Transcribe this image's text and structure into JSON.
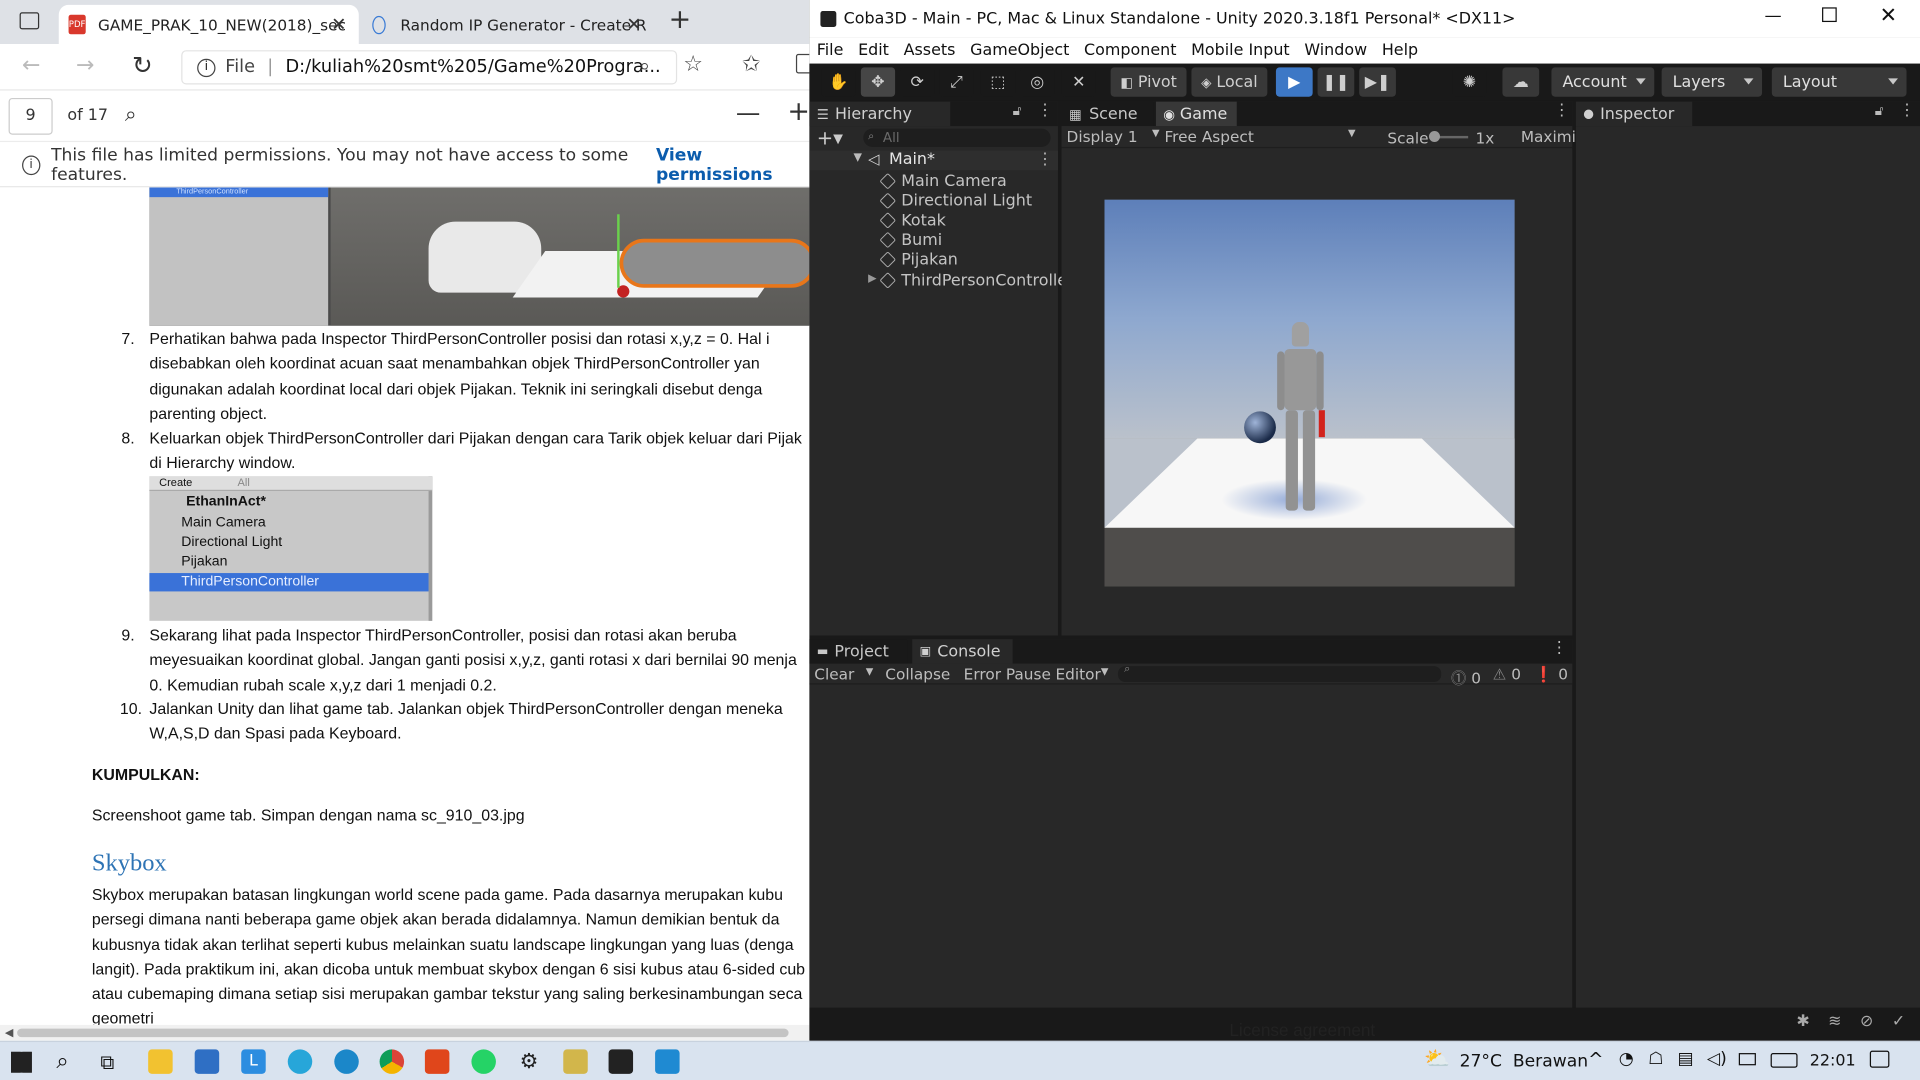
{
  "browser": {
    "tabs": [
      {
        "title": "GAME_PRAK_10_NEW(2018)_sec"
      },
      {
        "title": "Random IP Generator - Create R"
      }
    ],
    "address_scheme": "File",
    "address": "D:/kuliah%20smt%205/Game%20Progra...",
    "pdf": {
      "page": "9",
      "of": "of 17"
    },
    "notice": "This file has limited permissions. You may not have access to some features.",
    "notice_link": "View permissions"
  },
  "document": {
    "top_image_label": "ThirdPersonController",
    "items": [
      {
        "num": "7.",
        "lines": [
          "Perhatikan bahwa pada Inspector ThirdPersonController posisi dan rotasi x,y,z = 0. Hal i",
          "disebabkan oleh koordinat acuan saat menambahkan objek ThirdPersonController yan",
          "digunakan adalah koordinat local dari objek Pijakan.  Teknik ini seringkali disebut denga",
          "parenting object."
        ]
      },
      {
        "num": "8.",
        "lines": [
          "Keluarkan objek ThirdPersonController dari Pijakan dengan cara Tarik objek keluar dari Pijak",
          "di Hierarchy window."
        ]
      },
      {
        "num": "9.",
        "lines": [
          "Sekarang lihat pada Inspector ThirdPersonController, posisi dan rotasi akan beruba",
          "meyesuaikan koordinat global. Jangan ganti posisi x,y,z, ganti rotasi x dari bernilai 90 menja",
          "0. Kemudian rubah scale x,y,z dari 1 menjadi 0.2."
        ]
      },
      {
        "num": "10.",
        "lines": [
          "Jalankan Unity dan lihat game tab. Jalankan objek ThirdPersonController dengan meneka",
          "W,A,S,D dan Spasi pada Keyboard."
        ]
      }
    ],
    "embedded_hierarchy": {
      "create": "Create",
      "search": "All",
      "scene": "EthanInAct*",
      "items": [
        "Main Camera",
        "Directional Light",
        "Pijakan",
        "ThirdPersonController"
      ]
    },
    "kumpulkan_heading": "KUMPULKAN:",
    "kumpulkan_text": "Screenshoot game tab. Simpan dengan nama sc_910_03.jpg",
    "skybox_heading": "Skybox",
    "skybox_lines": [
      "Skybox merupakan batasan lingkungan world scene pada game. Pada dasarnya merupakan kubu",
      "persegi dimana nanti beberapa game objek akan berada didalamnya. Namun demikian bentuk da",
      "kubusnya tidak akan terlihat seperti kubus melainkan suatu landscape lingkungan yang luas (denga",
      "langit). Pada praktikum ini, akan dicoba untuk membuat skybox dengan 6 sisi kubus atau 6-sided cub",
      "atau cubemaping dimana setiap sisi merupakan gambar tekstur yang saling berkesinambungan seca",
      "geometri"
    ]
  },
  "unity": {
    "title": "Coba3D - Main - PC, Mac & Linux Standalone - Unity 2020.3.18f1 Personal* <DX11>",
    "menu": [
      "File",
      "Edit",
      "Assets",
      "GameObject",
      "Component",
      "Mobile Input",
      "Window",
      "Help"
    ],
    "toolbar": {
      "pivot": "Pivot",
      "local": "Local",
      "account": "Account",
      "layers": "Layers",
      "layout": "Layout"
    },
    "hierarchy": {
      "tab": "Hierarchy",
      "search": "All",
      "scene": "Main*",
      "items": [
        "Main Camera",
        "Directional Light",
        "Kotak",
        "Bumi",
        "Pijakan",
        "ThirdPersonControlle"
      ]
    },
    "scene_tab": "Scene",
    "game_tab": "Game",
    "game_bar": {
      "display": "Display 1",
      "aspect": "Free Aspect",
      "scale_label": "Scale",
      "scale_value": "1x",
      "maximize": "Maximi"
    },
    "inspector_tab": "Inspector",
    "bottom": {
      "project_tab": "Project",
      "console_tab": "Console",
      "clear": "Clear",
      "collapse": "Collapse",
      "error_pause": "Error Pause",
      "editor": "Editor",
      "count_log": "0",
      "count_warn": "0",
      "count_err": "0"
    }
  },
  "taskbar": {
    "weather": "27°C  Berawan",
    "time": "22:01",
    "behind_text": "License agreement"
  }
}
